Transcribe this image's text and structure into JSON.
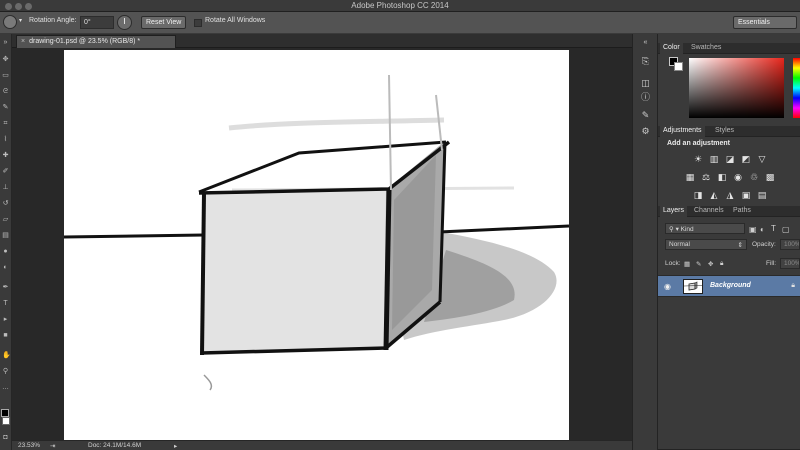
{
  "app": {
    "title": "Adobe Photoshop CC 2014"
  },
  "options": {
    "rotation_label": "Rotation Angle:",
    "rotation_value": "0°",
    "reset_label": "Reset View",
    "rotate_all_label": "Rotate All Windows",
    "rotate_all_checked": false
  },
  "workspace": {
    "label": "Essentials"
  },
  "document": {
    "tab_label": "drawing-01.psd @ 23.5% (RGB/8) *",
    "close_glyph": "×"
  },
  "status": {
    "zoom": "23.53%",
    "doc_label": "Doc: 24.1M/14.6M"
  },
  "color_panel": {
    "tabs": [
      "Color",
      "Swatches"
    ],
    "foreground": "#000000",
    "background": "#ffffff",
    "hue": "#e8261c"
  },
  "adjustments_panel": {
    "tabs": [
      "Adjustments",
      "Styles"
    ],
    "title": "Add an adjustment",
    "icons": [
      "brightness-icon",
      "levels-icon",
      "curves-icon",
      "exposure-icon",
      "vibrance-icon",
      "hue-saturation-icon",
      "color-balance-icon",
      "black-white-icon",
      "photo-filter-icon",
      "channel-mixer-icon",
      "color-lookup-icon",
      "invert-icon",
      "posterize-icon",
      "threshold-icon",
      "selective-color-icon",
      "gradient-map-icon"
    ]
  },
  "layers_panel": {
    "tabs": [
      "Layers",
      "Channels",
      "Paths"
    ],
    "filter": "Kind",
    "blend_mode": "Normal",
    "opacity_label": "Opacity:",
    "opacity_value": "100%",
    "lock_label": "Lock:",
    "fill_label": "Fill:",
    "fill_value": "100%",
    "layers": [
      {
        "name": "Background",
        "visible": true,
        "locked": true
      }
    ]
  },
  "colors": {
    "accent_selection": "#5b7aa5"
  }
}
